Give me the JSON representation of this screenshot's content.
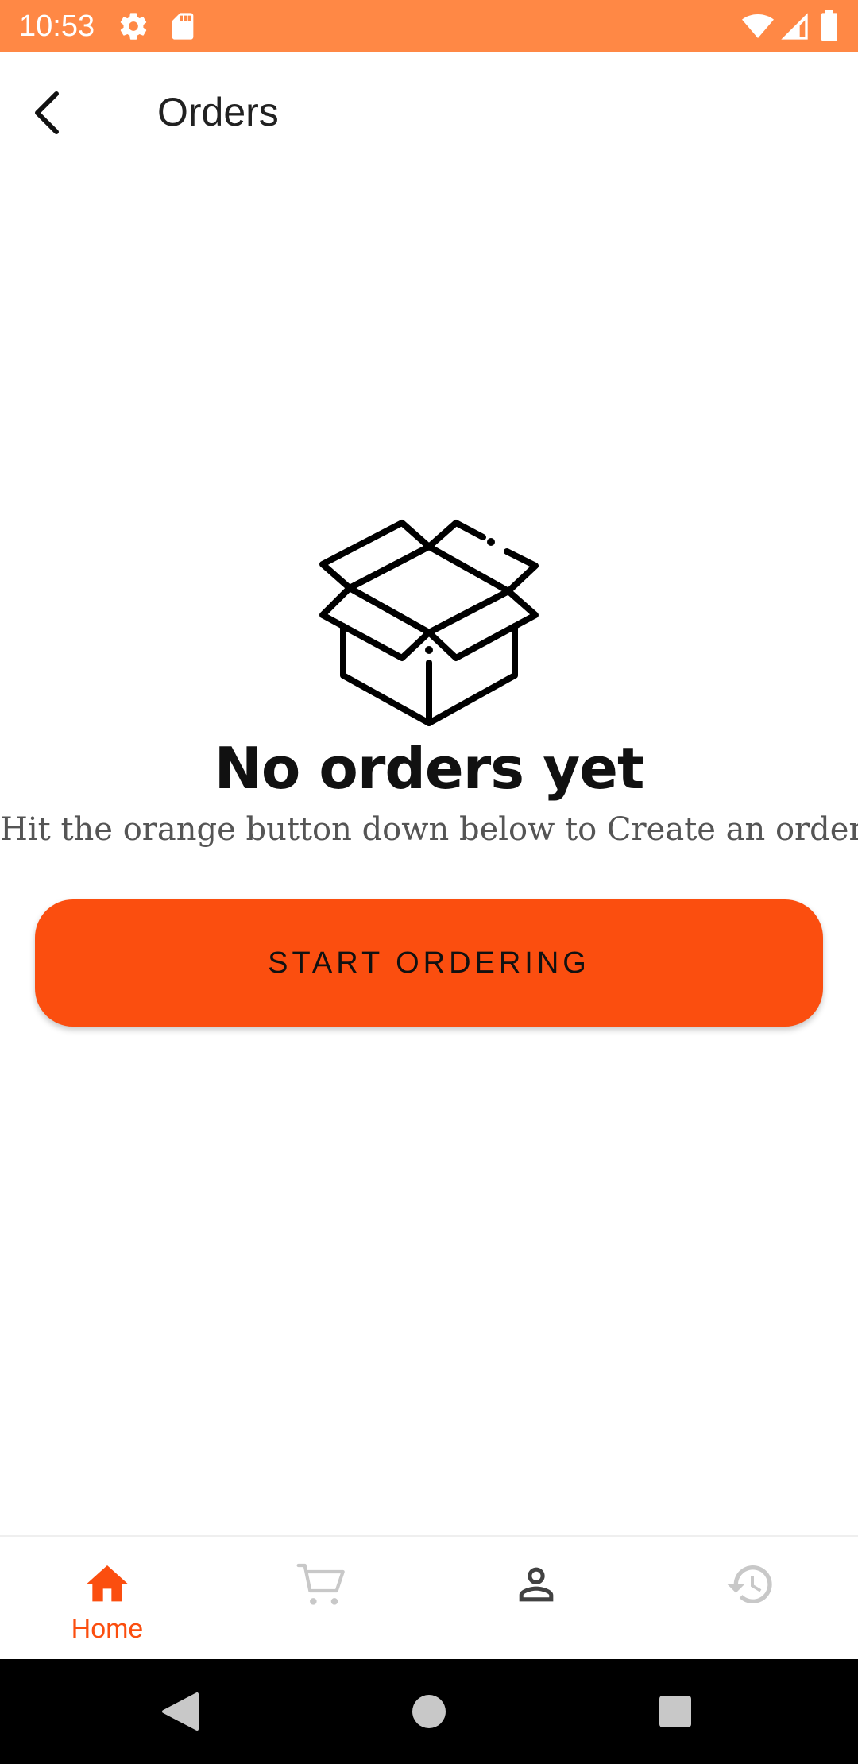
{
  "status_bar": {
    "time": "10:53",
    "background_color": "#ff8845",
    "left_icons": [
      "gear-icon",
      "sd-card-icon"
    ],
    "right_icons": [
      "wifi-icon",
      "cellular-signal-icon",
      "battery-icon"
    ]
  },
  "app_bar": {
    "back_icon": "arrow-back-icon",
    "title": "Orders"
  },
  "empty_state": {
    "illustration": "open-box-icon",
    "title": "No orders yet",
    "subtitle": "Hit the orange button down below to Create an order",
    "button_label": "START ORDERING",
    "button_color": "#fb4e0f"
  },
  "bottom_nav": {
    "items": [
      {
        "icon": "home-icon",
        "label": "Home",
        "active": true
      },
      {
        "icon": "cart-icon",
        "label": "",
        "active": false
      },
      {
        "icon": "profile-icon",
        "label": "",
        "active": false
      },
      {
        "icon": "history-icon",
        "label": "",
        "active": false
      }
    ],
    "active_color": "#fb4e0f"
  },
  "system_nav": {
    "buttons": [
      "back-triangle-icon",
      "home-circle-icon",
      "recents-square-icon"
    ]
  }
}
